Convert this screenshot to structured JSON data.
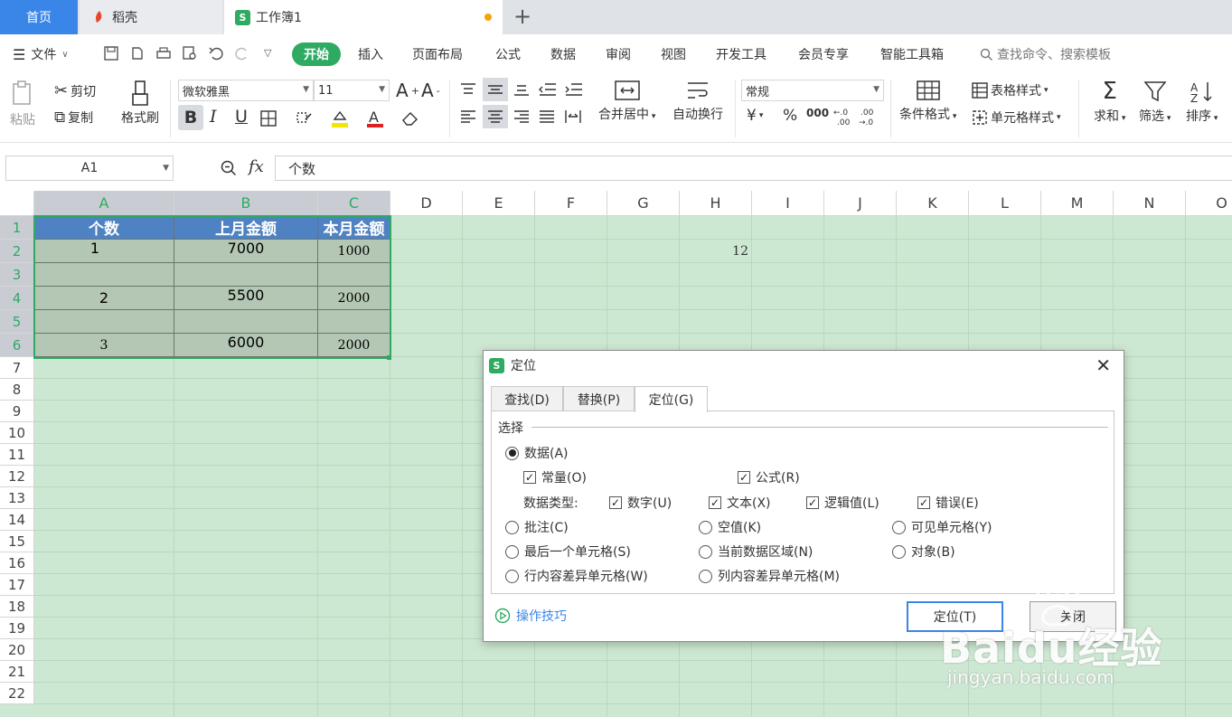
{
  "tabs": {
    "home": "首页",
    "daoke": "稻壳",
    "workbook": "工作簿1",
    "plus": "+"
  },
  "menu": {
    "file": "文件",
    "items": [
      "插入",
      "页面布局",
      "公式",
      "数据",
      "审阅",
      "视图",
      "开发工具",
      "会员专享",
      "智能工具箱"
    ],
    "active": "开始",
    "search": "查找命令、搜索模板"
  },
  "ribbon": {
    "paste": "粘贴",
    "cut": "剪切",
    "copy": "复制",
    "format_painter": "格式刷",
    "font": "微软雅黑",
    "font_size": "11",
    "bold": "B",
    "italic": "I",
    "underline": "U",
    "merge_center": "合并居中",
    "wrap": "自动换行",
    "number_format": "常规",
    "yen": "¥",
    "percent": "%",
    "thousand": "000",
    "cond_format": "条件格式",
    "table_style": "表格样式",
    "cell_style": "单元格样式",
    "sum": "求和",
    "filter": "筛选",
    "sort": "排序"
  },
  "formula": {
    "name_box": "A1",
    "fx": "fx",
    "content": "个数"
  },
  "columns": [
    "A",
    "B",
    "C",
    "D",
    "E",
    "F",
    "G",
    "H",
    "I",
    "J",
    "K",
    "L",
    "M",
    "N",
    "O"
  ],
  "rows": [
    "1",
    "2",
    "3",
    "4",
    "5",
    "6",
    "7",
    "8",
    "9",
    "10",
    "11",
    "12",
    "13",
    "14",
    "15",
    "16",
    "17",
    "18",
    "19",
    "20",
    "21",
    "22"
  ],
  "sheet": {
    "headers": [
      "个数",
      "上月金额",
      "本月金额"
    ],
    "r2": [
      "1",
      "7000",
      "1000"
    ],
    "r4": [
      "2",
      "5500",
      "2000"
    ],
    "r6": [
      "3",
      "6000",
      "2000"
    ],
    "h2": "12"
  },
  "dialog": {
    "title": "定位",
    "tabs": [
      "查找(D)",
      "替换(P)",
      "定位(G)"
    ],
    "group": "选择",
    "data": "数据(A)",
    "constant": "常量(O)",
    "formula": "公式(R)",
    "data_type": "数据类型:",
    "number": "数字(U)",
    "text": "文本(X)",
    "logical": "逻辑值(L)",
    "error": "错误(E)",
    "comment": "批注(C)",
    "blank": "空值(K)",
    "visible": "可见单元格(Y)",
    "last_cell": "最后一个单元格(S)",
    "current_region": "当前数据区域(N)",
    "object": "对象(B)",
    "row_diff": "行内容差异单元格(W)",
    "col_diff": "列内容差异单元格(M)",
    "tips": "操作技巧",
    "ok": "定位(T)",
    "close": "关闭"
  },
  "watermark": {
    "brand": "Baidu经验",
    "url": "jingyan.baidu.com"
  },
  "colors": {
    "accent": "#2eaa62",
    "tab_blue": "#3a86e8",
    "header_fill": "#4f82c2",
    "grid_bg": "#cde8d2"
  }
}
